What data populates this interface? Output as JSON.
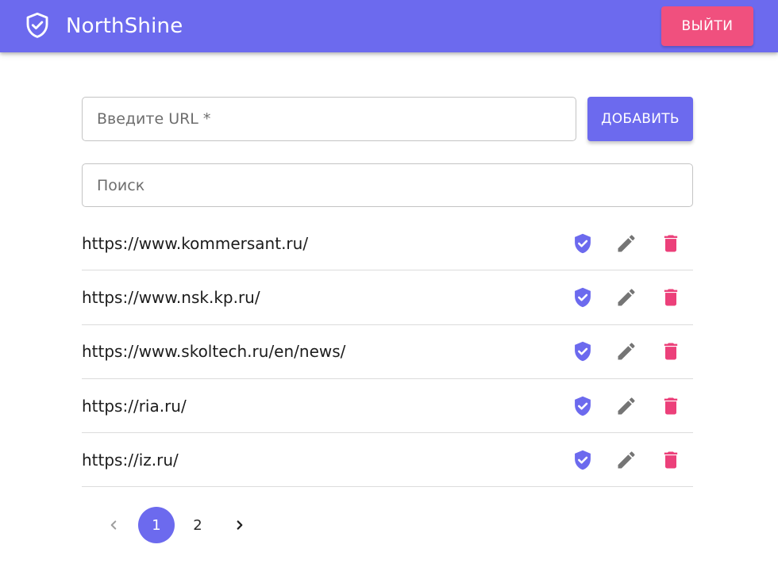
{
  "header": {
    "app_name": "NorthShine",
    "brand_icon": "shield-check-icon",
    "logout_label": "ВЫЙТИ",
    "bar_color": "#6c6aee",
    "logout_color": "#f0507e"
  },
  "add_form": {
    "url_placeholder": "Введите URL *",
    "url_value": "",
    "add_label": "ДОБАВИТЬ"
  },
  "search": {
    "placeholder": "Поиск",
    "value": ""
  },
  "urls": [
    {
      "url": "https://www.kommersant.ru/"
    },
    {
      "url": "https://www.nsk.kp.ru/"
    },
    {
      "url": "https://www.skoltech.ru/en/news/"
    },
    {
      "url": "https://ria.ru/"
    },
    {
      "url": "https://iz.ru/"
    }
  ],
  "row_actions": {
    "check_icon": "shield-check-icon",
    "edit_icon": "pencil-icon",
    "delete_icon": "trash-icon",
    "check_color": "#6c6aee",
    "edit_color": "#757575",
    "delete_color": "#ec407a"
  },
  "pagination": {
    "pages": [
      "1",
      "2"
    ],
    "current": "1",
    "prev_icon": "chevron-left-icon",
    "next_icon": "chevron-right-icon"
  }
}
